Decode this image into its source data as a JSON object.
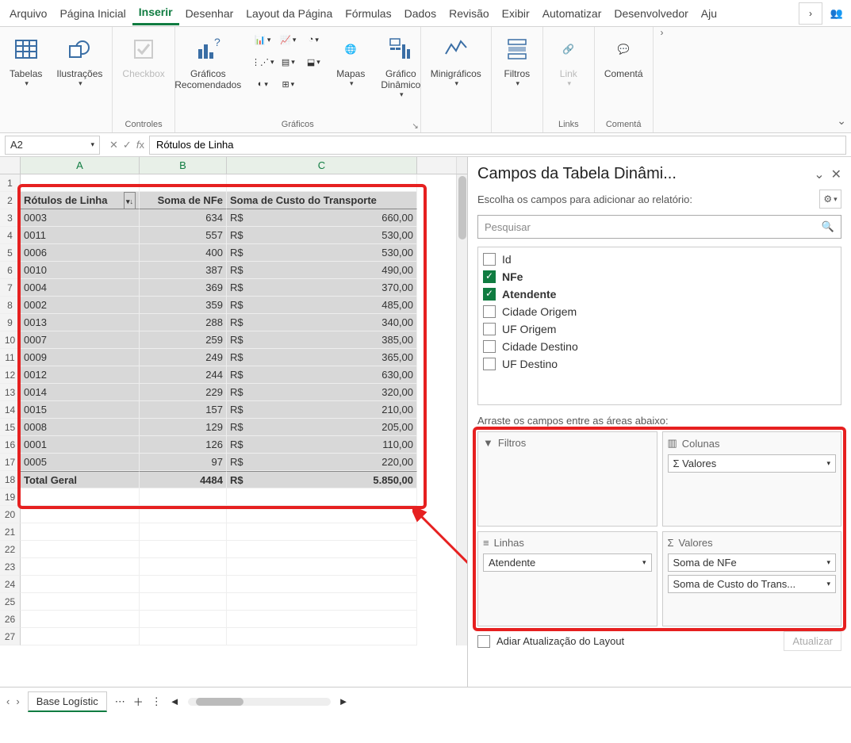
{
  "menu": {
    "items": [
      "Arquivo",
      "Página Inicial",
      "Inserir",
      "Desenhar",
      "Layout da Página",
      "Fórmulas",
      "Dados",
      "Revisão",
      "Exibir",
      "Automatizar",
      "Desenvolvedor",
      "Aju"
    ],
    "active_index": 2
  },
  "ribbon": {
    "tables": {
      "label": "Tabelas"
    },
    "illustrations": {
      "label": "Ilustrações"
    },
    "checkbox": {
      "label": "Checkbox"
    },
    "controls_group": "Controles",
    "rec_charts": {
      "label": "Gráficos\nRecomendados"
    },
    "maps": {
      "label": "Mapas"
    },
    "pivot_chart": {
      "label": "Gráfico\nDinâmico"
    },
    "charts_group": "Gráficos",
    "sparklines": {
      "label": "Minigráficos"
    },
    "filters": {
      "label": "Filtros"
    },
    "link": {
      "label": "Link"
    },
    "links_group": "Links",
    "comments": {
      "label": "Comentá"
    },
    "comments_group": "Comentá"
  },
  "name_box": "A2",
  "formula_value": "Rótulos de Linha",
  "chart_data": {
    "type": "table",
    "columns": [
      "Rótulos de Linha",
      "Soma de NFe",
      "Soma de Custo do Transporte"
    ],
    "rows": [
      {
        "label": "0003",
        "nfe": 634,
        "custo": "660,00"
      },
      {
        "label": "0011",
        "nfe": 557,
        "custo": "530,00"
      },
      {
        "label": "0006",
        "nfe": 400,
        "custo": "530,00"
      },
      {
        "label": "0010",
        "nfe": 387,
        "custo": "490,00"
      },
      {
        "label": "0004",
        "nfe": 369,
        "custo": "370,00"
      },
      {
        "label": "0002",
        "nfe": 359,
        "custo": "485,00"
      },
      {
        "label": "0013",
        "nfe": 288,
        "custo": "340,00"
      },
      {
        "label": "0007",
        "nfe": 259,
        "custo": "385,00"
      },
      {
        "label": "0009",
        "nfe": 249,
        "custo": "365,00"
      },
      {
        "label": "0012",
        "nfe": 244,
        "custo": "630,00"
      },
      {
        "label": "0014",
        "nfe": 229,
        "custo": "320,00"
      },
      {
        "label": "0015",
        "nfe": 157,
        "custo": "210,00"
      },
      {
        "label": "0008",
        "nfe": 129,
        "custo": "205,00"
      },
      {
        "label": "0001",
        "nfe": 126,
        "custo": "110,00"
      },
      {
        "label": "0005",
        "nfe": 97,
        "custo": "220,00"
      }
    ],
    "total": {
      "label": "Total Geral",
      "nfe": 4484,
      "custo": "5.850,00"
    },
    "currency_prefix": "R$"
  },
  "pane": {
    "title": "Campos da Tabela Dinâmi...",
    "subtitle": "Escolha os campos para adicionar ao relatório:",
    "search_placeholder": "Pesquisar",
    "fields": [
      {
        "name": "Id",
        "checked": false
      },
      {
        "name": "NFe",
        "checked": true
      },
      {
        "name": "Atendente",
        "checked": true
      },
      {
        "name": "Cidade Origem",
        "checked": false
      },
      {
        "name": "UF Origem",
        "checked": false
      },
      {
        "name": "Cidade Destino",
        "checked": false
      },
      {
        "name": "UF Destino",
        "checked": false
      }
    ],
    "drag_hint": "Arraste os campos entre as áreas abaixo:",
    "area_filters": "Filtros",
    "area_columns": "Colunas",
    "area_rows": "Linhas",
    "area_values": "Valores",
    "col_pill": "Σ  Valores",
    "row_pill": "Atendente",
    "val_pill1": "Soma de NFe",
    "val_pill2": "Soma de Custo do Trans...",
    "defer_label": "Adiar Atualização do Layout",
    "update_btn": "Atualizar"
  },
  "sheet_tab": "Base Logístic",
  "col_headers": [
    "A",
    "B",
    "C"
  ]
}
